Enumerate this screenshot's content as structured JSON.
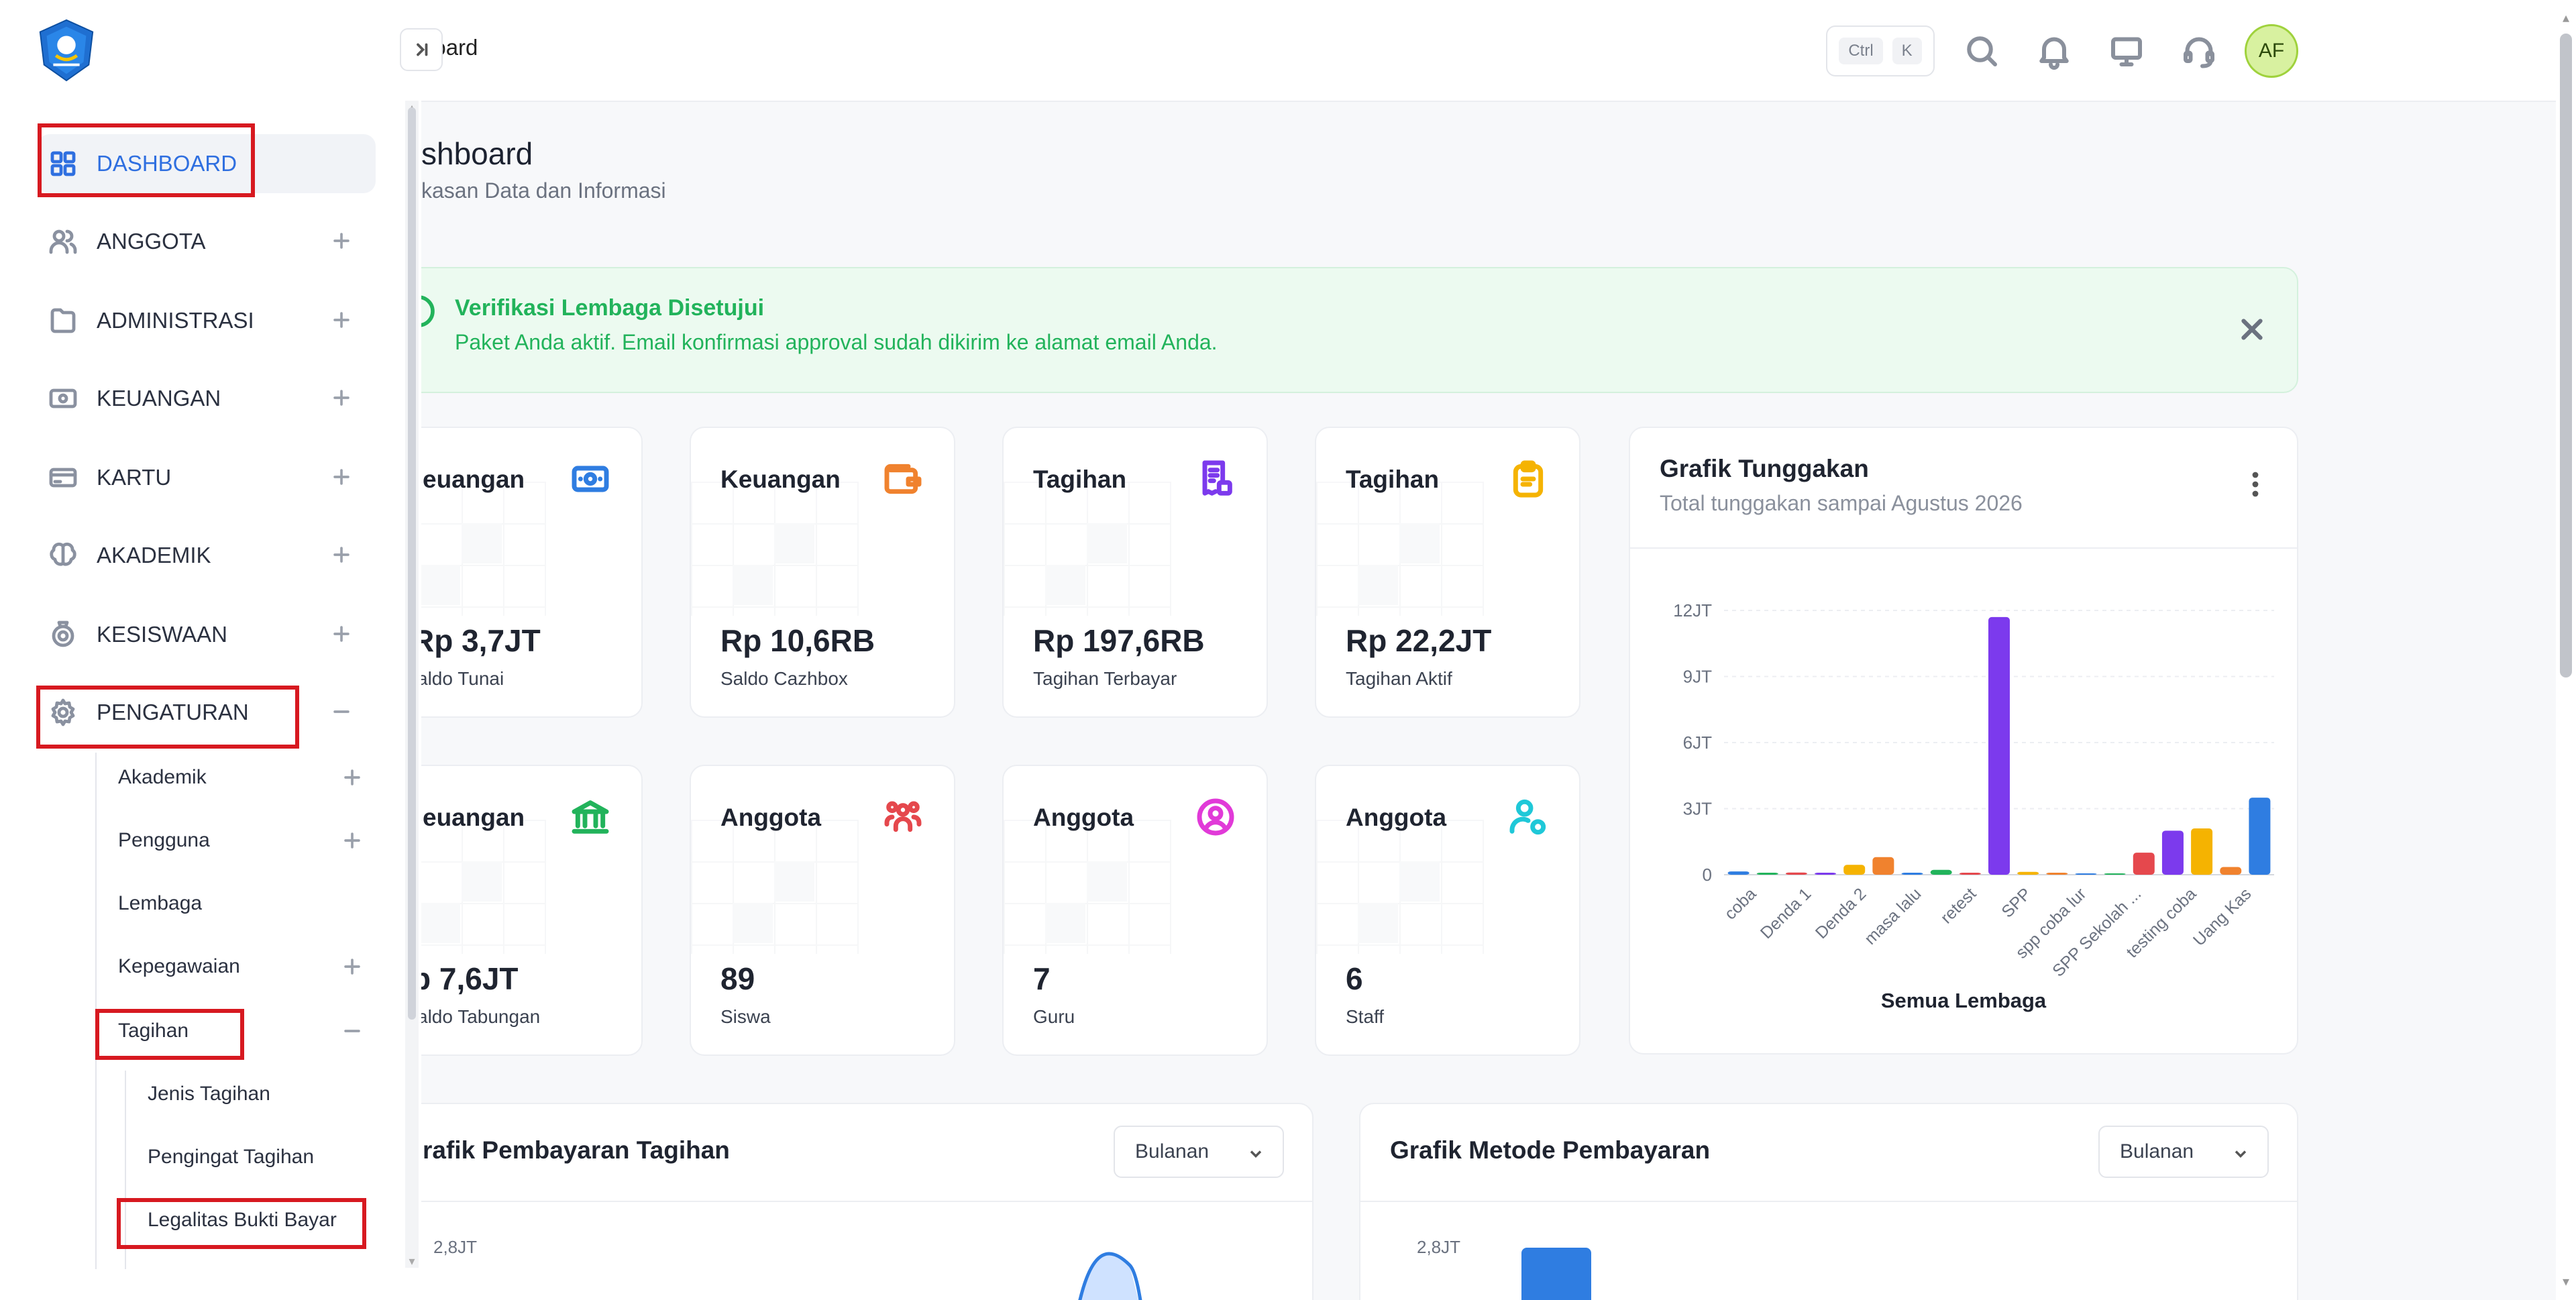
{
  "header": {
    "breadcrumb": "board",
    "kbd_ctrl": "Ctrl",
    "kbd_k": "K",
    "avatar_initials": "AF",
    "icons": [
      "search-icon",
      "bell-icon",
      "monitor-icon",
      "headset-icon"
    ]
  },
  "sidebar": {
    "items": [
      {
        "label": "DASHBOARD",
        "icon": "grid-icon"
      },
      {
        "label": "ANGGOTA",
        "icon": "users-icon"
      },
      {
        "label": "ADMINISTRASI",
        "icon": "folder-icon"
      },
      {
        "label": "KEUANGAN",
        "icon": "money-icon"
      },
      {
        "label": "KARTU",
        "icon": "card-icon"
      },
      {
        "label": "AKADEMIK",
        "icon": "brain-icon"
      },
      {
        "label": "KESISWAAN",
        "icon": "badge-icon"
      },
      {
        "label": "PENGATURAN",
        "icon": "gear-icon"
      }
    ],
    "pengaturan_sub": [
      "Akademik",
      "Pengguna",
      "Lembaga",
      "Kepegawaian",
      "Tagihan"
    ],
    "tagihan_sub": [
      "Jenis Tagihan",
      "Pengingat Tagihan",
      "Legalitas Bukti Bayar"
    ]
  },
  "page": {
    "title": "shboard",
    "subtitle": "kasan Data dan Informasi"
  },
  "alert": {
    "title": "Verifikasi Lembaga Disetujui",
    "message": "Paket Anda aktif. Email konfirmasi approval sudah dikirim ke alamat email Anda."
  },
  "cards": [
    {
      "title": "euangan",
      "value": "Rp 3,7JT",
      "label": "aldo Tunai",
      "icon": "cash-icon",
      "color": "#2f7de1"
    },
    {
      "title": "Keuangan",
      "value": "Rp 10,6RB",
      "label": "Saldo Cazhbox",
      "icon": "wallet-icon",
      "color": "#f0822e"
    },
    {
      "title": "Tagihan",
      "value": "Rp 197,6RB",
      "label": "Tagihan Terbayar",
      "icon": "invoice-check-icon",
      "color": "#7c3aed"
    },
    {
      "title": "Tagihan",
      "value": "Rp 22,2JT",
      "label": "Tagihan Aktif",
      "icon": "clipboard-icon",
      "color": "#f5b301"
    },
    {
      "title": "euangan",
      "value": "p 7,6JT",
      "label": "aldo Tabungan",
      "icon": "bank-icon",
      "color": "#22b35b"
    },
    {
      "title": "Anggota",
      "value": "89",
      "label": "Siswa",
      "icon": "group-icon",
      "color": "#e5484d"
    },
    {
      "title": "Anggota",
      "value": "7",
      "label": "Guru",
      "icon": "user-circle-icon",
      "color": "#e13ad8"
    },
    {
      "title": "Anggota",
      "value": "6",
      "label": "Staff",
      "icon": "user-settings-icon",
      "color": "#1fc8d8"
    }
  ],
  "chart_card": {
    "title": "Grafik Tunggakan",
    "subtitle": "Total tunggakan sampai Agustus 2026"
  },
  "chart_data": {
    "type": "bar",
    "xlabel": "Semua Lembaga",
    "ylim": [
      0,
      12000000
    ],
    "yticks": [
      0,
      3000000,
      6000000,
      9000000,
      12000000
    ],
    "ytick_labels": [
      "0",
      "3JT",
      "6JT",
      "9JT",
      "12JT"
    ],
    "x_tick_labels": [
      "coba",
      "Denda 1",
      "Denda 2",
      "masa lalu",
      "retest",
      "SPP",
      "spp coba lur",
      "SPP Sekolah ...",
      "testing coba",
      "Uang Kas"
    ],
    "bars": [
      {
        "value": 150000,
        "color": "#2f7de1"
      },
      {
        "value": 50000,
        "color": "#22b35b"
      },
      {
        "value": 100000,
        "color": "#e5484d"
      },
      {
        "value": 80000,
        "color": "#7c3aed"
      },
      {
        "value": 450000,
        "color": "#f5b301"
      },
      {
        "value": 800000,
        "color": "#f0822e"
      },
      {
        "value": 40000,
        "color": "#2f7de1"
      },
      {
        "value": 220000,
        "color": "#22b35b"
      },
      {
        "value": 40000,
        "color": "#e5484d"
      },
      {
        "value": 11700000,
        "color": "#7c3aed"
      },
      {
        "value": 130000,
        "color": "#f5b301"
      },
      {
        "value": 80000,
        "color": "#f0822e"
      },
      {
        "value": 0,
        "color": "#2f7de1"
      },
      {
        "value": 0,
        "color": "#22b35b"
      },
      {
        "value": 1000000,
        "color": "#e5484d"
      },
      {
        "value": 2000000,
        "color": "#7c3aed"
      },
      {
        "value": 2100000,
        "color": "#f5b301"
      },
      {
        "value": 350000,
        "color": "#f0822e"
      },
      {
        "value": 3500000,
        "color": "#2f7de1"
      }
    ]
  },
  "bottom_cards": [
    {
      "title": "rafik Pembayaran Tagihan",
      "select": "Bulanan",
      "ytick": "2,8JT"
    },
    {
      "title": "Grafik Metode Pembayaran",
      "select": "Bulanan",
      "ytick": "2,8JT"
    }
  ]
}
